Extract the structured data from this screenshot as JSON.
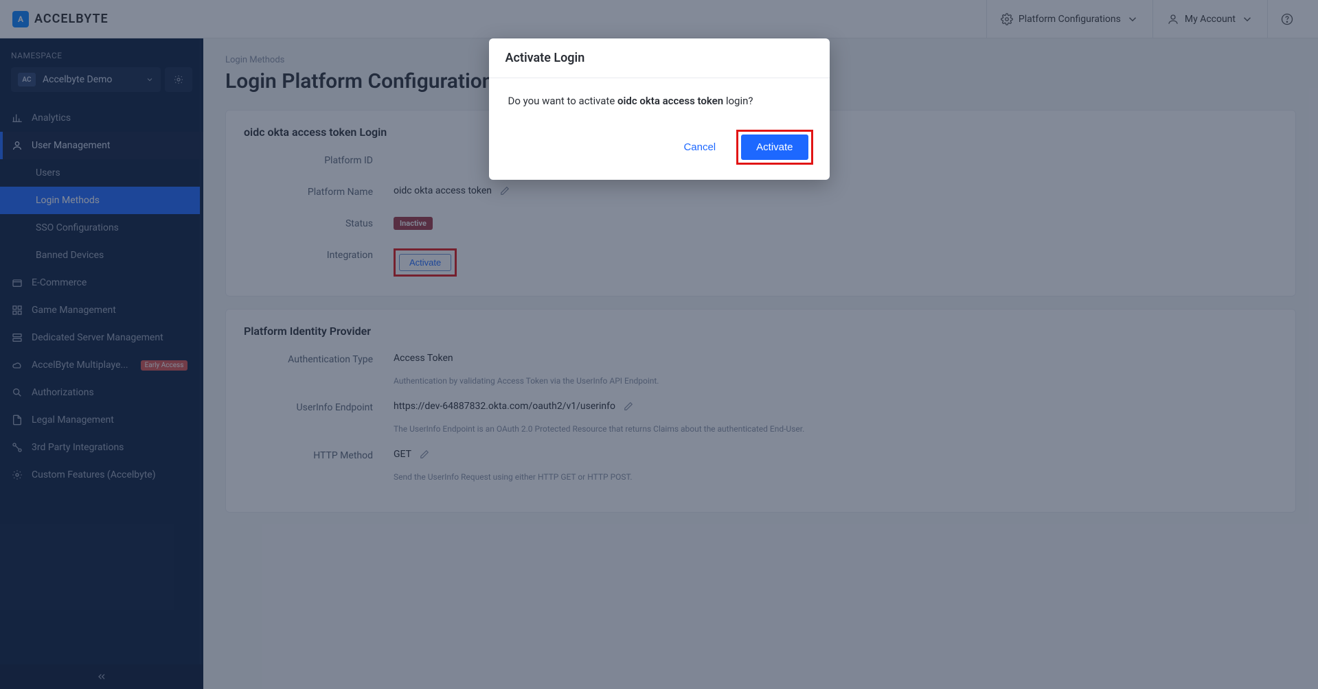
{
  "header": {
    "brand": "ACCELBYTE",
    "platform_config": "Platform Configurations",
    "my_account": "My Account"
  },
  "sidebar": {
    "ns_label": "NAMESPACE",
    "ns_badge": "AC",
    "ns_name": "Accelbyte Demo",
    "items": [
      {
        "icon": "analytics",
        "label": "Analytics"
      },
      {
        "icon": "user",
        "label": "User Management",
        "expanded": true
      },
      {
        "icon": "cart",
        "label": "E-Commerce"
      },
      {
        "icon": "grid",
        "label": "Game Management"
      },
      {
        "icon": "server",
        "label": "Dedicated Server Management"
      },
      {
        "icon": "cloud",
        "label": "AccelByte Multiplaye...",
        "badge": "Early Access"
      },
      {
        "icon": "search",
        "label": "Authorizations"
      },
      {
        "icon": "doc",
        "label": "Legal Management"
      },
      {
        "icon": "integrations",
        "label": "3rd Party Integrations"
      },
      {
        "icon": "gear",
        "label": "Custom Features (Accelbyte)"
      }
    ],
    "sub_items": [
      "Users",
      "Login Methods",
      "SSO Configurations",
      "Banned Devices"
    ]
  },
  "main": {
    "breadcrumb": "Login Methods",
    "page_title": "Login Platform Configuration",
    "card1": {
      "title": "oidc okta access token Login",
      "fields": {
        "platform_id_label": "Platform ID",
        "platform_id_value": "",
        "platform_name_label": "Platform Name",
        "platform_name_value": "oidc okta access token",
        "status_label": "Status",
        "status_value": "Inactive",
        "integration_label": "Integration",
        "integration_btn": "Activate"
      }
    },
    "card2": {
      "title": "Platform Identity Provider",
      "fields": {
        "auth_type_label": "Authentication Type",
        "auth_type_value": "Access Token",
        "auth_type_help": "Authentication by validating Access Token via the UserInfo API Endpoint.",
        "userinfo_label": "UserInfo Endpoint",
        "userinfo_value": "https://dev-64887832.okta.com/oauth2/v1/userinfo",
        "userinfo_help": "The UserInfo Endpoint is an OAuth 2.0 Protected Resource that returns Claims about the authenticated End-User.",
        "http_label": "HTTP Method",
        "http_value": "GET",
        "http_help": "Send the UserInfo Request using either HTTP GET or HTTP POST."
      }
    }
  },
  "modal": {
    "title": "Activate Login",
    "body_pre": "Do you want to activate ",
    "body_bold": "oidc okta access token",
    "body_post": " login?",
    "cancel": "Cancel",
    "confirm": "Activate"
  }
}
